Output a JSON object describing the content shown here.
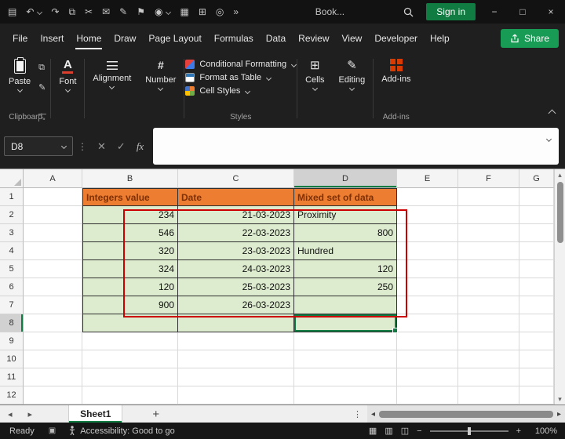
{
  "colors": {
    "excel_green": "#107C41",
    "share_green": "#189B54",
    "header_fill": "#ED7D31",
    "header_text": "#7F3005",
    "data_fill": "#DDEBCF",
    "annotation_red": "#CC0000",
    "addins_orange": "#D83B01",
    "font_color_red": "#E03E2D"
  },
  "titlebar": {
    "quick_access_icons": [
      {
        "name": "save-icon",
        "glyph": "▤"
      },
      {
        "name": "undo-icon",
        "glyph": "↶",
        "caret": true
      },
      {
        "name": "redo-icon",
        "glyph": "↷"
      },
      {
        "name": "copy-icon",
        "glyph": "⧉"
      },
      {
        "name": "cut-icon",
        "glyph": "✂"
      },
      {
        "name": "mail-icon",
        "glyph": "✉"
      },
      {
        "name": "pen-icon",
        "glyph": "✎"
      },
      {
        "name": "flag-icon",
        "glyph": "⚑"
      },
      {
        "name": "eye-icon",
        "glyph": "◉",
        "caret": true
      },
      {
        "name": "print-icon",
        "glyph": "▦"
      },
      {
        "name": "grid-icon",
        "glyph": "⊞"
      },
      {
        "name": "camera-icon",
        "glyph": "◎"
      },
      {
        "name": "overflow-icon",
        "glyph": "»"
      }
    ],
    "document_name": "Book...",
    "sign_in_label": "Sign in",
    "window_controls": [
      {
        "name": "minimize-button",
        "glyph": "−"
      },
      {
        "name": "maximize-button",
        "glyph": "□"
      },
      {
        "name": "close-button",
        "glyph": "×"
      }
    ]
  },
  "menubar": {
    "items": [
      "File",
      "Insert",
      "Home",
      "Draw",
      "Page Layout",
      "Formulas",
      "Data",
      "Review",
      "View",
      "Developer",
      "Help"
    ],
    "active": "Home",
    "share_label": "Share"
  },
  "ribbon": {
    "clipboard": {
      "label": "Clipboard",
      "paste_label": "Paste"
    },
    "font": {
      "label": "Font",
      "icon_letter": "A"
    },
    "alignment": {
      "label": "Alignment"
    },
    "number": {
      "label": "Number"
    },
    "styles": {
      "label": "Styles",
      "items": [
        "Conditional Formatting",
        "Format as Table",
        "Cell Styles"
      ]
    },
    "cells": {
      "label": "Cells"
    },
    "editing": {
      "label": "Editing"
    },
    "addins": {
      "label": "Add-ins",
      "group_label": "Add-ins"
    }
  },
  "icons": {
    "copy_mini": "⧉",
    "format_painter": "✎",
    "number_icon": "#",
    "cells_icon": "⊞",
    "editing_icon": "✎",
    "namebox_separator": "⋮",
    "scroll_up": "▴",
    "scroll_down": "▾",
    "tab_prev": "◂",
    "tab_next": "▸",
    "tab_menu": "⋮",
    "hscroll_left": "◂",
    "hscroll_right": "▸",
    "macro_record": "▣",
    "view_normal": "▦",
    "view_page_layout": "▥",
    "view_page_break": "◫"
  },
  "formula_bar": {
    "name_box_value": "D8",
    "buttons": {
      "cancel": "✕",
      "enter": "✓",
      "insert_function": "fx"
    },
    "formula_value": ""
  },
  "grid": {
    "column_headers": [
      "A",
      "B",
      "C",
      "D",
      "E",
      "F",
      "G"
    ],
    "row_headers": [
      "1",
      "2",
      "3",
      "4",
      "5",
      "6",
      "7",
      "8",
      "9",
      "10",
      "11",
      "12"
    ],
    "active_cell": "D8",
    "selected_column": "D",
    "selected_row": "8",
    "table": {
      "origin": "B1",
      "header_row": [
        "Integers value",
        "Date",
        "Mixed set of data"
      ],
      "rows": [
        [
          "234",
          "21-03-2023",
          "Proximity"
        ],
        [
          "546",
          "22-03-2023",
          "800"
        ],
        [
          "320",
          "23-03-2023",
          "Hundred"
        ],
        [
          "324",
          "24-03-2023",
          "120"
        ],
        [
          "120",
          "25-03-2023",
          "250"
        ],
        [
          "900",
          "26-03-2023",
          ""
        ]
      ]
    }
  },
  "sheet_tabs": {
    "tabs": [
      {
        "label": "Sheet1",
        "active": true
      }
    ],
    "add_label": "+"
  },
  "status_bar": {
    "mode": "Ready",
    "accessibility": "Accessibility: Good to go",
    "zoom_out": "−",
    "zoom_in": "+",
    "zoom": "100%"
  }
}
